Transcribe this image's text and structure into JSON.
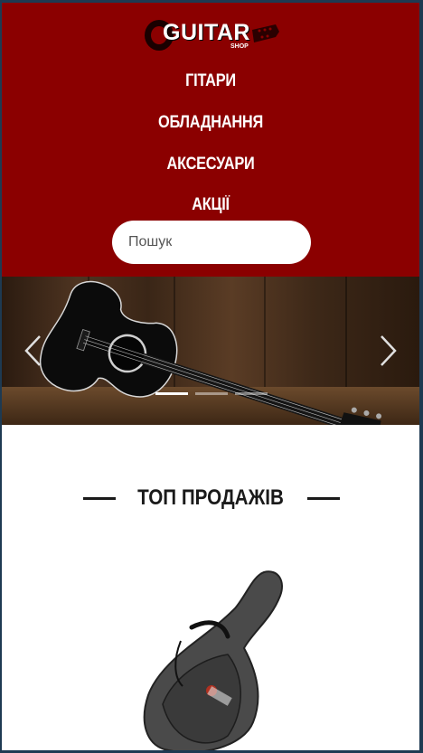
{
  "header": {
    "logo": {
      "main": "GUITAR",
      "sub": "SHOP"
    },
    "nav": [
      {
        "label": "ГІТАРИ"
      },
      {
        "label": "ОБЛАДНАННЯ"
      },
      {
        "label": "АКСЕСУАРИ"
      },
      {
        "label": "АКЦІЇ"
      }
    ],
    "search": {
      "placeholder": "Пошук",
      "value": ""
    }
  },
  "slider": {
    "slides_count": 3,
    "active_slide": 1,
    "prev_icon": "chevron-left-icon",
    "next_icon": "chevron-right-icon"
  },
  "top_sales": {
    "title": "ТОП ПРОДАЖІВ"
  },
  "colors": {
    "header_bg": "#8b0000",
    "page_bg": "#ffffff",
    "text_dark": "#1a1a1a"
  }
}
